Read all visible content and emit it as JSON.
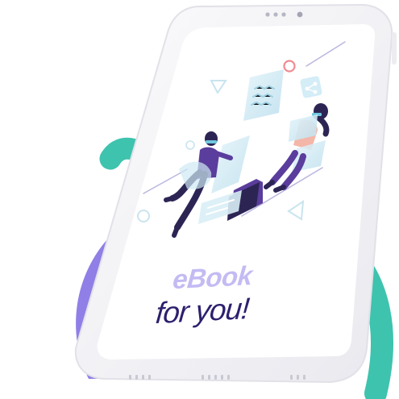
{
  "cover": {
    "title_line1": "eBook",
    "title_line2": "for you!"
  },
  "colors": {
    "tablet_frame": "#f4f4f6",
    "tablet_edge": "#e3e3ea",
    "screen": "#ffffff",
    "teal_ribbon": "#3ec3ae",
    "purple_blob": "#8f7fe6",
    "title_line1": "#c3bbf3",
    "title_line2": "#2e1f6e",
    "dark_navy": "#2c2554",
    "violet": "#5a3d9c",
    "pale_blue": "#cfe9f4",
    "accent_pink": "#f08a92",
    "light_lines": "#b9b6de"
  },
  "icons": [
    "share-icon",
    "triangle-outline-icon",
    "circle-outline-icon",
    "folder-icon"
  ]
}
